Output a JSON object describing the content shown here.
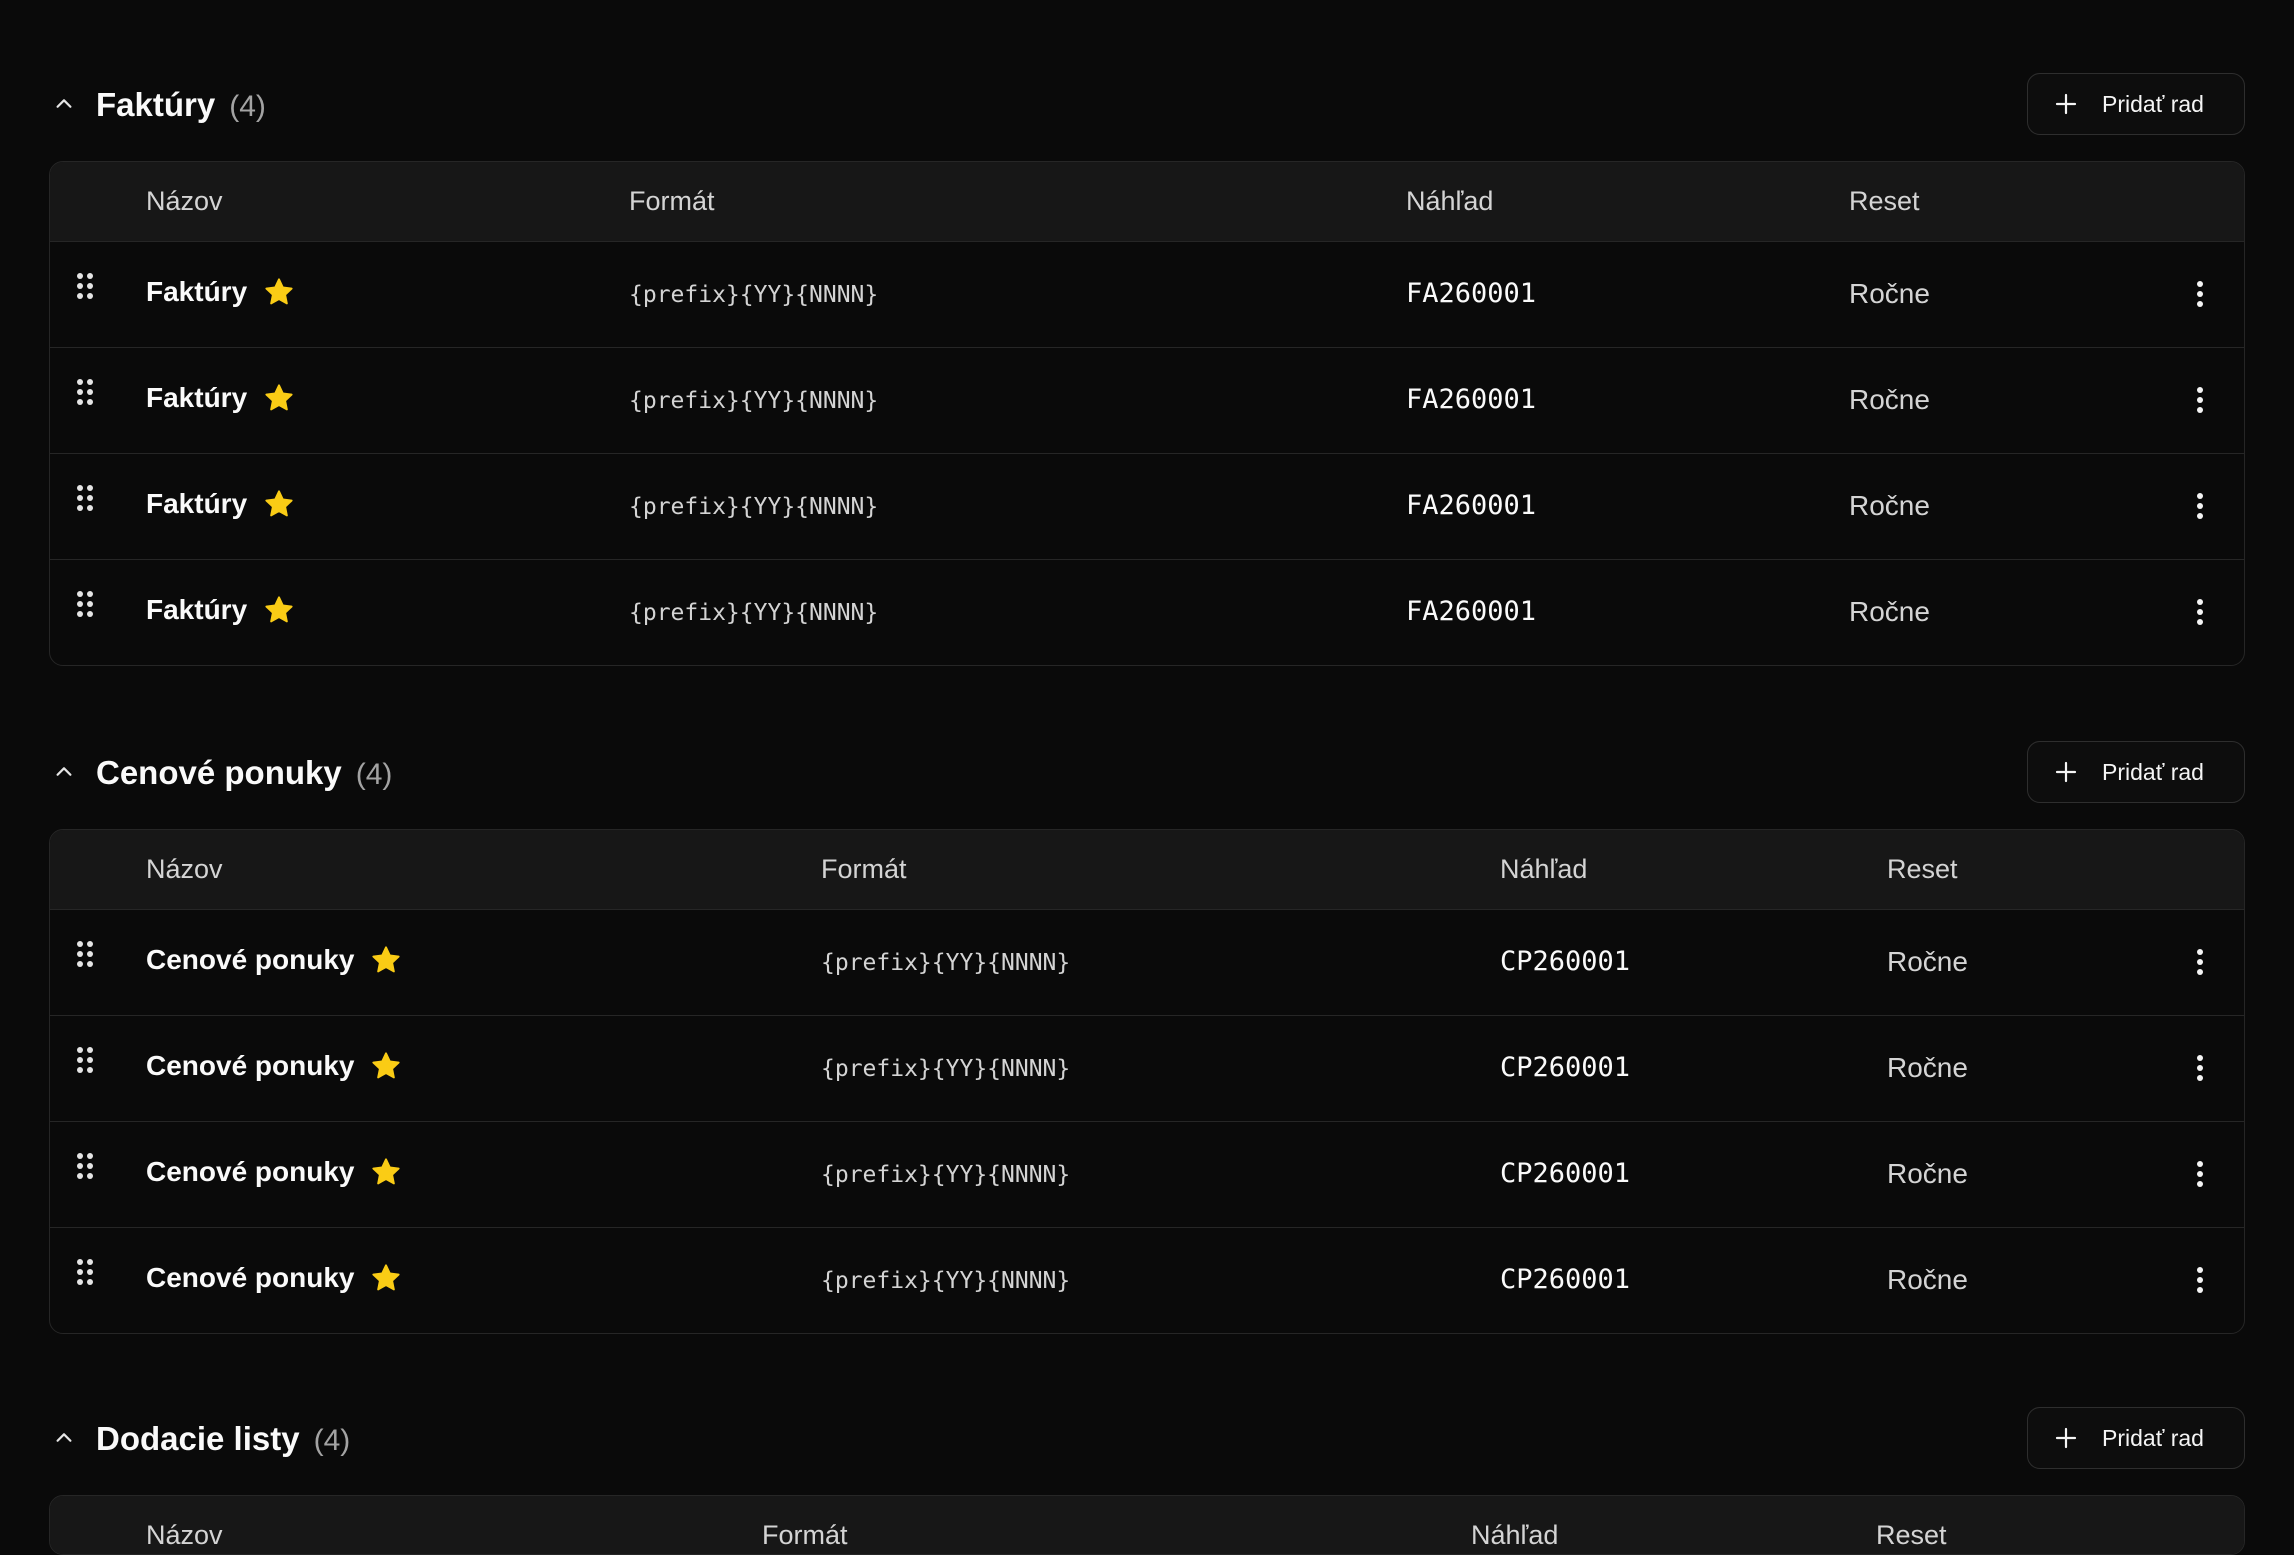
{
  "sections": [
    {
      "title": "Faktúry",
      "count": "(4)",
      "add_label": "Pridať rad",
      "columns": [
        "Názov",
        "Formát",
        "Náhľad",
        "Reset"
      ],
      "rows": [
        {
          "name": "Faktúry",
          "format": "{prefix}{YY}{NNNN}",
          "preview": "FA260001",
          "reset": "Ročne"
        },
        {
          "name": "Faktúry",
          "format": "{prefix}{YY}{NNNN}",
          "preview": "FA260001",
          "reset": "Ročne"
        },
        {
          "name": "Faktúry",
          "format": "{prefix}{YY}{NNNN}",
          "preview": "FA260001",
          "reset": "Ročne"
        },
        {
          "name": "Faktúry",
          "format": "{prefix}{YY}{NNNN}",
          "preview": "FA260001",
          "reset": "Ročne"
        }
      ]
    },
    {
      "title": "Cenové ponuky",
      "count": "(4)",
      "add_label": "Pridať rad",
      "columns": [
        "Názov",
        "Formát",
        "Náhľad",
        "Reset"
      ],
      "rows": [
        {
          "name": "Cenové ponuky",
          "format": "{prefix}{YY}{NNNN}",
          "preview": "CP260001",
          "reset": "Ročne"
        },
        {
          "name": "Cenové ponuky",
          "format": "{prefix}{YY}{NNNN}",
          "preview": "CP260001",
          "reset": "Ročne"
        },
        {
          "name": "Cenové ponuky",
          "format": "{prefix}{YY}{NNNN}",
          "preview": "CP260001",
          "reset": "Ročne"
        },
        {
          "name": "Cenové ponuky",
          "format": "{prefix}{YY}{NNNN}",
          "preview": "CP260001",
          "reset": "Ročne"
        }
      ]
    },
    {
      "title": "Dodacie listy",
      "count": "(4)",
      "add_label": "Pridať rad",
      "columns": [
        "Názov",
        "Formát",
        "Náhľad",
        "Reset"
      ],
      "rows": []
    }
  ],
  "icons": {
    "collapse": "chevron-up-icon",
    "add": "plus-icon",
    "drag": "drag-handle-icon",
    "default": "star-icon",
    "menu": "more-vertical-icon"
  },
  "colors": {
    "background": "#0a0a0a",
    "header_bg": "#171717",
    "border": "#262626",
    "star": "#facc15"
  }
}
